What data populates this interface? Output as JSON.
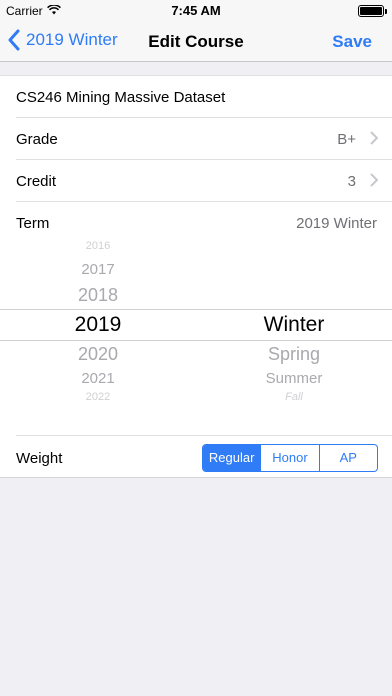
{
  "status": {
    "carrier": "Carrier",
    "time": "7:45 AM"
  },
  "nav": {
    "back": "2019 Winter",
    "title": "Edit Course",
    "save": "Save"
  },
  "course": {
    "name": "CS246 Mining Massive Dataset"
  },
  "rows": {
    "grade": {
      "label": "Grade",
      "value": "B+"
    },
    "credit": {
      "label": "Credit",
      "value": "3"
    },
    "term": {
      "label": "Term",
      "value": "2019 Winter"
    },
    "weight": {
      "label": "Weight"
    }
  },
  "picker": {
    "years": [
      "2016",
      "2017",
      "2018",
      "2019",
      "2020",
      "2021",
      "2022"
    ],
    "selected_year": "2019",
    "seasons": [
      "Winter",
      "Spring",
      "Summer",
      "Fall"
    ],
    "selected_season": "Winter"
  },
  "weight_options": [
    "Regular",
    "Honor",
    "AP"
  ],
  "weight_selected": "Regular",
  "colors": {
    "accent": "#2f7cf6",
    "secondary_text": "#6f6f74",
    "picker_dim": "#a9a9ae"
  },
  "icons": {
    "back": "chevron-left-icon",
    "wifi": "wifi-icon",
    "battery": "battery-icon"
  }
}
